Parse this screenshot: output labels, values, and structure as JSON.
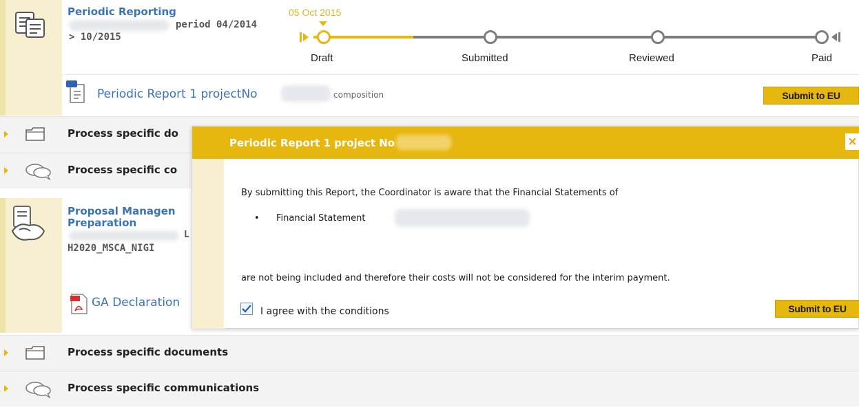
{
  "periodic": {
    "title": "Periodic Reporting",
    "period_line1": "period 04/2014",
    "period_line2": "> 10/2015",
    "date": "05 Oct 2015",
    "steps": [
      "Draft",
      "Submitted",
      "Reviewed",
      "Paid"
    ],
    "progress": 0.12
  },
  "report_row": {
    "link": "Periodic Report 1 projectNo",
    "composition": "composition",
    "submit_label": "Submit to EU"
  },
  "section1": {
    "documents": "Process specific do",
    "communications": "Process specific co"
  },
  "proposal": {
    "title_line1": "Proposal Managen",
    "title_line2": "Preparation",
    "code_line1": "L",
    "code_line2": "H2020_MSCA_NIGI",
    "declaration_link": "GA Declaration"
  },
  "section2": {
    "documents": "Process specific documents",
    "communications": "Process specific communications"
  },
  "modal": {
    "title": "Periodic Report 1 project No",
    "close": "×",
    "intro": "By submitting this Report, the Coordinator is aware that the Financial Statements of",
    "bullet": "Financial Statement",
    "outro": "are not being included and therefore their costs will not be considered for the interim payment.",
    "agree": "I agree with the conditions",
    "agree_checked": true,
    "submit_label": "Submit to EU"
  },
  "colors": {
    "accent": "#e6b70f",
    "link": "#3b73b5",
    "timeline_gray": "#7d7d7d"
  }
}
